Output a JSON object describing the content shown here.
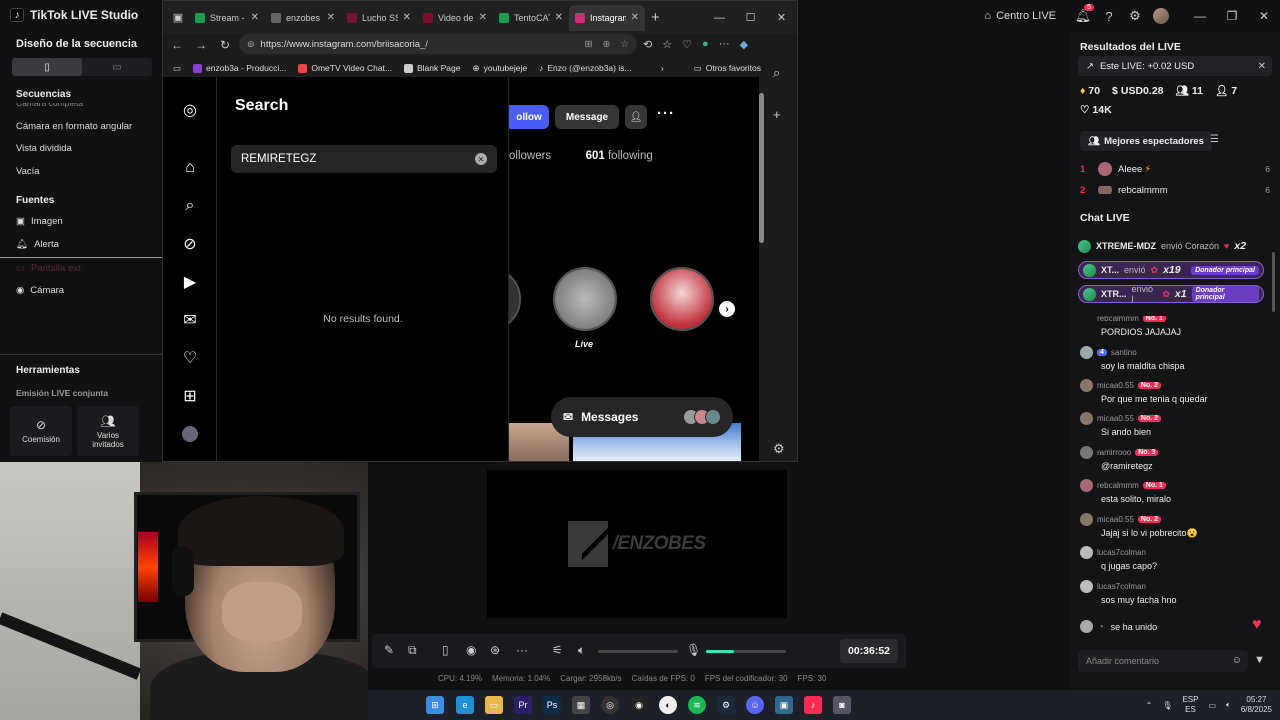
{
  "studio": {
    "app_title": "TikTok LIVE Studio",
    "centro_label": "Centro LIVE",
    "notif_count": "5"
  },
  "left_panel": {
    "design_title": "Diseño de la secuencia",
    "sequences_title": "Secuencias",
    "sequences": [
      "Cámara completa",
      "Cámara en formato angular",
      "Vista dividida",
      "Vacía"
    ],
    "sources_title": "Fuentes",
    "sources": [
      "Imagen",
      "Alerta",
      "Pantalla ext",
      "Cámara"
    ],
    "tools_title": "Herramientas",
    "joint_label": "Emisión LIVE conjunta",
    "tools": [
      "Coemisión",
      "Varios invitados"
    ]
  },
  "browser": {
    "tabs": [
      {
        "label": "Stream - K",
        "color": "#17a34a"
      },
      {
        "label": "enzobes",
        "color": "#666666"
      },
      {
        "label": "Lucho SSJ",
        "color": "#7a1030"
      },
      {
        "label": "Video del",
        "color": "#7a1030"
      },
      {
        "label": "TentoCAT",
        "color": "#17a34a"
      },
      {
        "label": "Instagram",
        "color": "#d62976"
      }
    ],
    "url": "https://www.instagram.com/briisacoria_/",
    "bookmarks": [
      "enzob3a - Producci...",
      "OmeTV Video Chat...",
      "Blank Page",
      "youtubejeje",
      "Enzo (@enzob3a) is..."
    ],
    "other_favorites": "Otros favoritos"
  },
  "instagram": {
    "search_title": "Search",
    "search_value": "REMIRETEGZ",
    "no_results": "No results found.",
    "follow_label": "ollow",
    "message_label": "Message",
    "followers_label": "ollowers",
    "following_count": "601",
    "following_label": "following",
    "highlight_label": "Live",
    "messages_label": "Messages"
  },
  "preview": {
    "logo_text": "/ENZOBES"
  },
  "controls": {
    "timer": "00:36:52",
    "volume_level": 0.35,
    "stats": [
      "CPU: 4.19%",
      "Memoria: 1.04%",
      "Cargar: 2958kb/s",
      "Caídas de FPS: 0",
      "FPS del codificador: 30",
      "FPS: 30"
    ]
  },
  "taskbar": {
    "lang1": "ESP",
    "lang2": "ES",
    "time": "05:27",
    "date": "6/8/2025"
  },
  "live_panel": {
    "results_title": "Resultados del LIVE",
    "estimate": "Este LIVE: +0.02 USD",
    "metric_gems": "70",
    "metric_usd": "USD0.28",
    "metric_viewers": "11",
    "metric_follows": "7",
    "likes": "14K",
    "best_viewers_label": "Mejores espectadores",
    "ranking": [
      {
        "rank": "1",
        "name": "Aleee",
        "score": "6"
      },
      {
        "rank": "2",
        "name": "rebcalmmm",
        "score": "6"
      }
    ],
    "chat_title": "Chat LIVE",
    "gifts": [
      {
        "name": "XTREME-MDZ",
        "action": "envió Corazón",
        "mult": "x2",
        "donor": ""
      },
      {
        "name": "XT...",
        "action": "envió",
        "mult": "x19",
        "donor": "Donador principal"
      },
      {
        "name": "XTR...",
        "action": "envió l",
        "mult": "x1",
        "donor": "Donador principal"
      }
    ],
    "messages": [
      {
        "user": "rebcalmmm",
        "badge": "No. 1",
        "text": "PORDIOS JAJAJAJ"
      },
      {
        "user": "santino",
        "badge": "4",
        "text": "soy la maldita chispa"
      },
      {
        "user": "micaa0.55",
        "badge": "No. 2",
        "text": "Por que me tenia q quedar"
      },
      {
        "user": "micaa0.55",
        "badge": "No. 2",
        "text": "Si ando bien"
      },
      {
        "user": "ramirrooo",
        "badge": "No. 3",
        "text": "@ramiretegz"
      },
      {
        "user": "rebcalmmm",
        "badge": "No. 1",
        "text": "esta solito, miralo"
      },
      {
        "user": "micaa0.55",
        "badge": "No. 2",
        "text": "Jajaj si lo vi pobrecito😮"
      },
      {
        "user": "lucas7colman",
        "badge": "",
        "text": "q jugas capo?"
      },
      {
        "user": "lucas7colman",
        "badge": "",
        "text": "sos muy facha hno"
      }
    ],
    "joined_text": "se ha unido",
    "comment_placeholder": "Añadir comentario"
  }
}
